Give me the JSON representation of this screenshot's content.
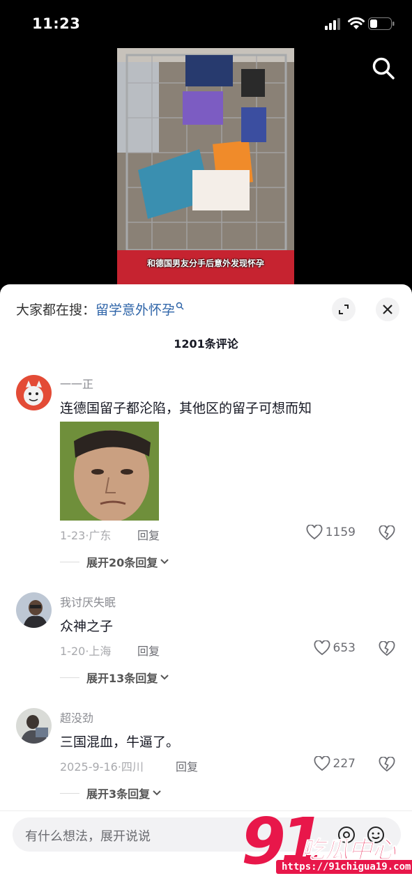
{
  "status_bar": {
    "time": "11:23"
  },
  "video": {
    "subtitle": "和德国男友分手后意外发现怀孕"
  },
  "sheet": {
    "trending_prefix": "大家都在搜：",
    "trending_keyword": "留学意外怀孕",
    "comment_count": "1201条评论"
  },
  "comments": [
    {
      "user": "一一正",
      "text": "连德国留子都沦陷，其他区的留子可想而知",
      "date": "1-23",
      "location": "广东",
      "reply": "回复",
      "likes": "1159",
      "expand": "展开20条回复"
    },
    {
      "user": "我讨厌失眠",
      "text": "众神之子",
      "date": "1-20",
      "location": "上海",
      "reply": "回复",
      "likes": "653",
      "expand": "展开13条回复"
    },
    {
      "user": "超没劲",
      "text": "三国混血，牛逼了。",
      "date": "2025-9-16",
      "location": "四川",
      "reply": "回复",
      "likes": "227",
      "expand": "展开3条回复"
    }
  ],
  "input": {
    "placeholder": "有什么想法，展开说说"
  },
  "watermark": {
    "brand_number": "91",
    "brand_name": "吃瓜中心",
    "url": "https://91chigua19.com"
  },
  "colors": {
    "accent_link": "#2e64a8",
    "watermark": "#e8174a"
  }
}
